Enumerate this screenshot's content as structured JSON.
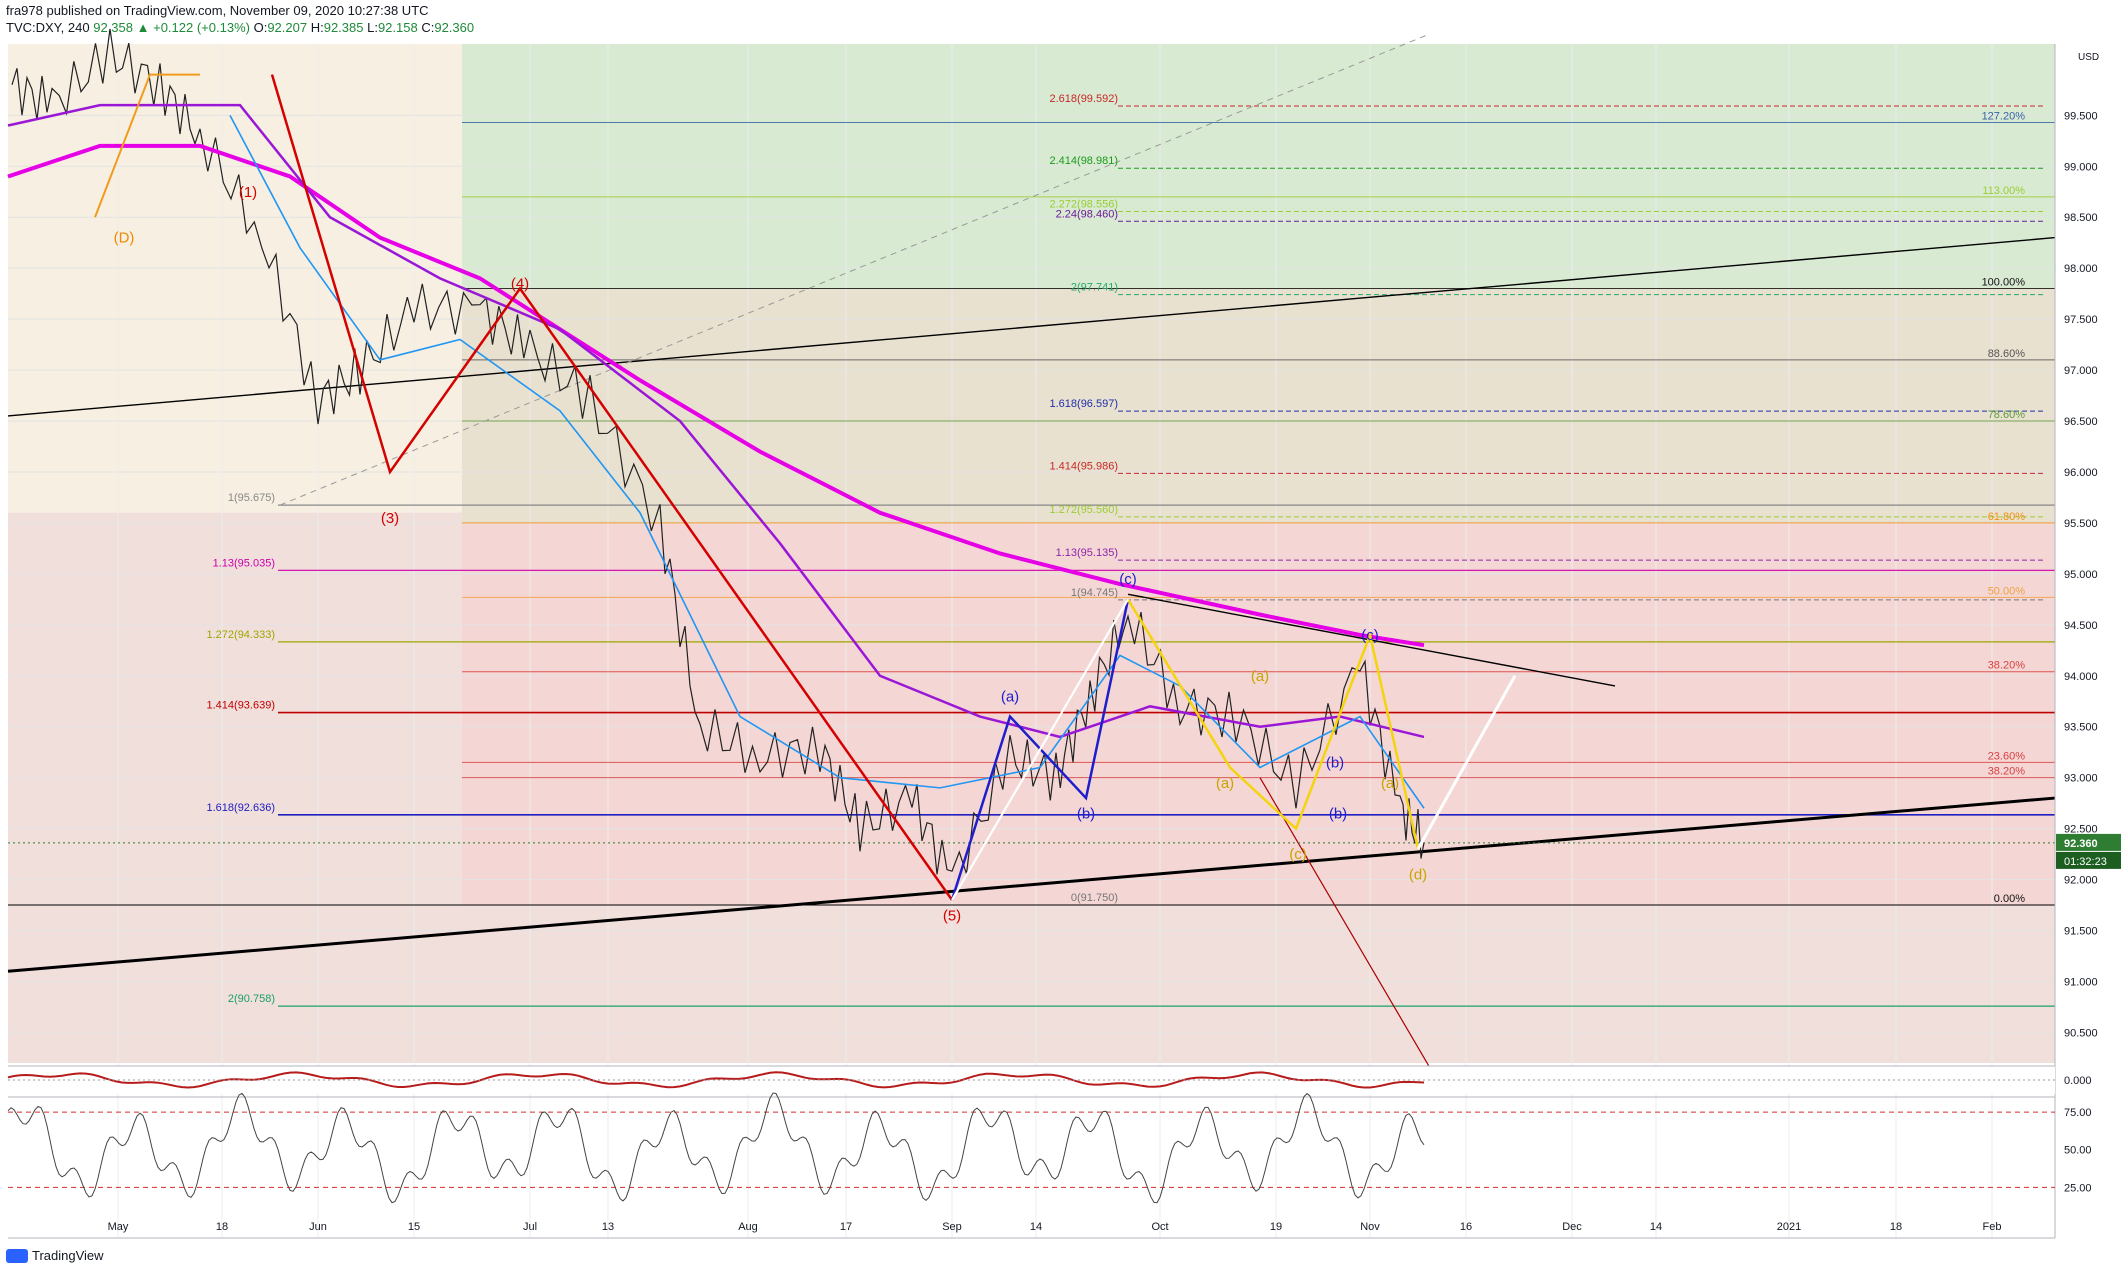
{
  "header": {
    "line1": "fra978 published on TradingView.com, November 09, 2020 10:27:38 UTC",
    "symbol": "TVC:DXY, 240",
    "price": "92.358",
    "change": "+0.122 (+0.13%)",
    "o_label": "O:",
    "o": "92.207",
    "h_label": "H:",
    "h": "92.385",
    "l_label": "L:",
    "l": "92.158",
    "c_label": "C:",
    "c": "92.360"
  },
  "footer": {
    "brand": "TradingView"
  },
  "colors": {
    "magenta_ma": "#e600e6",
    "purple_ma": "#9b17d6",
    "blue_ma": "#2196f3",
    "wave_red": "#d50000",
    "wave_blue": "#1e1ecc",
    "wave_yellow": "#f4d40c",
    "up": "#2e7d32",
    "bg_green": "#d9ead3",
    "bg_red": "#f4d7d4"
  },
  "chart_data": [
    {
      "type": "line",
      "title": "",
      "xlabel": "",
      "ylabel": "",
      "currency": "USD",
      "ylim": [
        90.2,
        100.2
      ],
      "y_ticks": [
        "99.500",
        "99.000",
        "98.500",
        "98.000",
        "97.500",
        "97.000",
        "96.500",
        "96.000",
        "95.500",
        "95.000",
        "94.500",
        "94.000",
        "93.500",
        "93.000",
        "92.500",
        "92.000",
        "91.500",
        "91.000",
        "90.500"
      ],
      "x_ticks": [
        "May",
        "18",
        "Jun",
        "15",
        "Jul",
        "13",
        "Aug",
        "17",
        "Sep",
        "14",
        "Oct",
        "19",
        "Nov",
        "16",
        "Dec",
        "14",
        "2021",
        "18",
        "Feb"
      ],
      "last_price": "92.360",
      "countdown": "01:32:23",
      "series": [
        {
          "x": [
            "Apr 27",
            "May 4",
            "May 11",
            "May 18",
            "May 25",
            "Jun 1",
            "Jun 8",
            "Jun 15",
            "Jun 22",
            "Jun 29",
            "Jul 6",
            "Jul 13",
            "Jul 20",
            "Jul 27",
            "Aug 3",
            "Aug 10",
            "Aug 17",
            "Aug 24",
            "Aug 31",
            "Sep 7",
            "Sep 14",
            "Sep 21",
            "Sep 28",
            "Oct 5",
            "Oct 12",
            "Oct 19",
            "Oct 26",
            "Nov 2",
            "Nov 9"
          ],
          "values": [
            99.8,
            99.6,
            100.1,
            99.8,
            99.3,
            98.3,
            96.7,
            97.0,
            97.6,
            97.6,
            97.2,
            96.7,
            95.5,
            93.5,
            93.2,
            93.3,
            92.5,
            92.8,
            92.0,
            93.2,
            93.0,
            93.8,
            94.6,
            93.7,
            93.6,
            92.9,
            94.1,
            92.7,
            92.36
          ]
        }
      ],
      "fib_levels_left": [
        {
          "label": "1(95.675)",
          "value": 95.675
        },
        {
          "label": "1.13(95.035)",
          "value": 95.035
        },
        {
          "label": "1.272(94.333)",
          "value": 94.333
        },
        {
          "label": "1.414(93.639)",
          "value": 93.639
        },
        {
          "label": "1.618(92.636)",
          "value": 92.636
        },
        {
          "label": "2(90.758)",
          "value": 90.758
        }
      ],
      "fib_levels_mid": [
        {
          "label": "2.618(99.592)",
          "value": 99.592
        },
        {
          "label": "2.414(98.981)",
          "value": 98.981
        },
        {
          "label": "2.272(98.556)",
          "value": 98.556
        },
        {
          "label": "2.24(98.460)",
          "value": 98.46
        },
        {
          "label": "2(97.741)",
          "value": 97.741
        },
        {
          "label": "1.618(96.597)",
          "value": 96.597
        },
        {
          "label": "1.414(95.986)",
          "value": 95.986
        },
        {
          "label": "1.272(95.560)",
          "value": 95.56
        },
        {
          "label": "1.13(95.135)",
          "value": 95.135
        },
        {
          "label": "1(94.745)",
          "value": 94.745
        },
        {
          "label": "0(91.750)",
          "value": 91.75
        }
      ],
      "retracement_levels": [
        {
          "label": "127.20%",
          "value": 99.43
        },
        {
          "label": "113.00%",
          "value": 98.7
        },
        {
          "label": "100.00%",
          "value": 97.8
        },
        {
          "label": "88.60%",
          "value": 97.1
        },
        {
          "label": "78.60%",
          "value": 96.5
        },
        {
          "label": "61.80%",
          "value": 95.5
        },
        {
          "label": "50.00%",
          "value": 94.77
        },
        {
          "label": "38.20%",
          "value": 94.04
        },
        {
          "label": "23.60%",
          "value": 93.15
        },
        {
          "label": "38.20%",
          "value": 93.0
        },
        {
          "label": "0.00%",
          "value": 91.75
        }
      ],
      "wave_labels": [
        "(D)",
        "(1)",
        "(4)",
        "(3)",
        "(5)",
        "(a)",
        "(b)",
        "(c)",
        "(a)",
        "(b)",
        "(c)",
        "(d)",
        "(a)",
        "(c)",
        "(b)",
        "(a)"
      ]
    },
    {
      "type": "line",
      "title": "",
      "ylim": [
        -0.02,
        0.02
      ],
      "y_ticks": [
        "0.000"
      ]
    },
    {
      "type": "line",
      "title": "",
      "ylim": [
        10,
        85
      ],
      "y_ticks": [
        "75.00",
        "50.00",
        "25.00"
      ]
    }
  ]
}
